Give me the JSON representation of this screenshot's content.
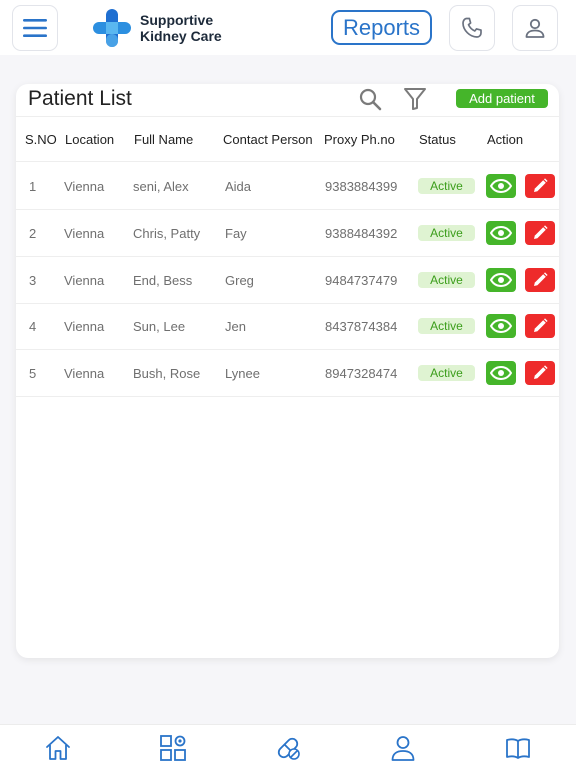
{
  "header": {
    "brand_line1": "Supportive",
    "brand_line2": "Kidney Care",
    "reports_label": "Reports"
  },
  "card": {
    "title": "Patient List",
    "add_patient_label": "Add patient"
  },
  "table": {
    "columns": [
      "S.NO",
      "Location",
      "Full Name",
      "Contact Person",
      "Proxy Ph.no",
      "Status",
      "Action"
    ],
    "rows": [
      {
        "sno": "1",
        "location": "Vienna",
        "name": "seni, Alex",
        "contact": "Aida",
        "phone": "9383884399",
        "status": "Active"
      },
      {
        "sno": "2",
        "location": "Vienna",
        "name": "Chris, Patty",
        "contact": "Fay",
        "phone": "9388484392",
        "status": "Active"
      },
      {
        "sno": "3",
        "location": "Vienna",
        "name": "End, Bess",
        "contact": "Greg",
        "phone": "9484737479",
        "status": "Active"
      },
      {
        "sno": "4",
        "location": "Vienna",
        "name": "Sun, Lee",
        "contact": "Jen",
        "phone": "8437874384",
        "status": "Active"
      },
      {
        "sno": "5",
        "location": "Vienna",
        "name": "Bush, Rose",
        "contact": "Lynee",
        "phone": "8947328474",
        "status": "Active"
      }
    ]
  },
  "icons": {
    "menu": "hamburger-icon",
    "phone": "phone-icon",
    "user": "user-icon",
    "search": "search-icon",
    "filter": "filter-icon",
    "view": "eye-icon",
    "edit": "pencil-icon",
    "nav": [
      "home-icon",
      "dashboard-icon",
      "medication-icon",
      "profile-icon",
      "book-icon"
    ]
  },
  "colors": {
    "brand_blue": "#2a74c9",
    "green": "#45b52a",
    "red": "#ee2b2b",
    "active_badge_bg": "#dff3d2",
    "active_badge_text": "#3b9d1a"
  }
}
